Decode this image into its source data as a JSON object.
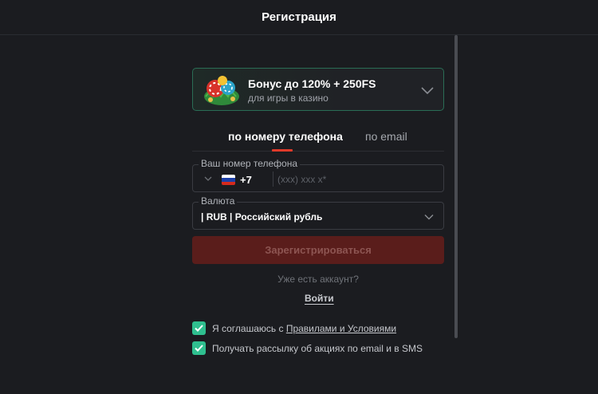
{
  "header": {
    "title": "Регистрация"
  },
  "bonus": {
    "title": "Бонус до 120% + 250FS",
    "subtitle": "для игры в казино"
  },
  "tabs": [
    {
      "label": "по номеру телефона",
      "active": true
    },
    {
      "label": "по email",
      "active": false
    }
  ],
  "phone": {
    "label": "Ваш номер телефона",
    "country_code": "+7",
    "placeholder": "(xxx) xxx x*"
  },
  "currency": {
    "label": "Валюта",
    "value": "| RUB | Российский рубль"
  },
  "submit": {
    "label": "Зарегистрироваться"
  },
  "login": {
    "prompt": "Уже есть аккаунт?",
    "link": "Войти"
  },
  "consents": [
    {
      "prefix": "Я соглашаюсь с ",
      "link": "Правилами и Условиями",
      "checked": true
    },
    {
      "text": "Получать рассылку об акциях по email и в SMS",
      "checked": true
    }
  ],
  "colors": {
    "accent_green": "#2fbf8f",
    "tab_indicator": "#e03a2a",
    "submit_bg": "#5a1d1b",
    "background": "#1b1c20"
  }
}
